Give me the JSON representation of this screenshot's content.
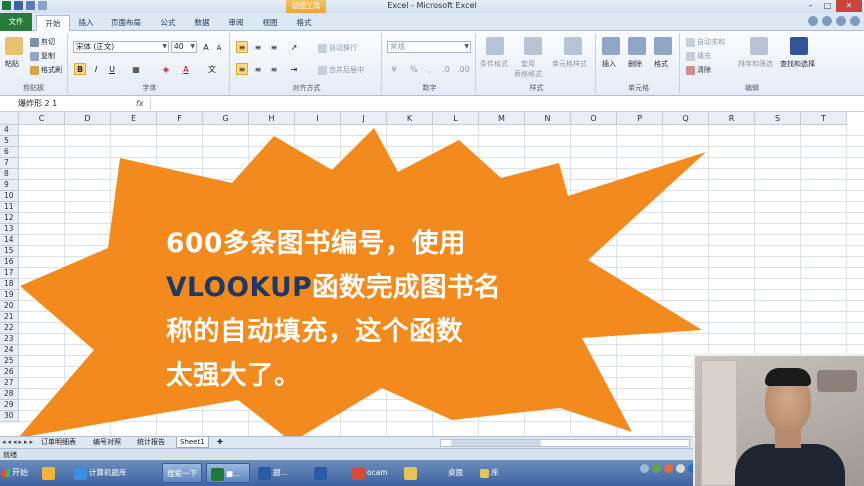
{
  "window": {
    "title": "Excel - Microsoft Excel",
    "context_tab": "绘图工具",
    "minimize": "–",
    "maximize": "□",
    "close": "✕"
  },
  "ribbon_tabs": [
    "文件",
    "开始",
    "插入",
    "页面布局",
    "公式",
    "数据",
    "审阅",
    "视图",
    "格式"
  ],
  "ribbon": {
    "clipboard": {
      "label": "剪贴板",
      "paste": "粘贴",
      "cut": "剪切",
      "copy": "复制",
      "format_painter": "格式刷"
    },
    "font": {
      "label": "字体",
      "font_name": "宋体 (正文)",
      "font_size": "40",
      "bold": "B",
      "italic": "I",
      "underline": "U"
    },
    "alignment": {
      "label": "对齐方式",
      "wrap": "自动换行",
      "merge": "合并后居中"
    },
    "number": {
      "label": "数字",
      "format": "常规",
      "percent": "%",
      "comma": ","
    },
    "styles": {
      "label": "样式",
      "conditional": "条件格式",
      "table": "套用\n表格格式",
      "cell": "单元格样式"
    },
    "cells": {
      "label": "单元格",
      "insert": "插入",
      "delete": "删除",
      "format": "格式"
    },
    "editing": {
      "label": "编辑",
      "autosum": "自动求和",
      "fill": "填充",
      "clear": "清除",
      "sort": "排序和筛选",
      "find": "查找和选择"
    }
  },
  "formula_bar": {
    "name_box": "爆炸形 2 1",
    "fx": "fx",
    "value": ""
  },
  "columns": [
    "C",
    "D",
    "E",
    "F",
    "G",
    "H",
    "I",
    "J",
    "K",
    "L",
    "M",
    "N",
    "O",
    "P",
    "Q",
    "R",
    "S",
    "T"
  ],
  "rows": [
    "4",
    "5",
    "6",
    "7",
    "8",
    "9",
    "10",
    "11",
    "12",
    "13",
    "14",
    "15",
    "16",
    "17",
    "18",
    "19",
    "20",
    "21",
    "22",
    "23",
    "24",
    "25",
    "26",
    "27",
    "28",
    "29",
    "30"
  ],
  "callout": {
    "line1": "600多条图书编号，使用",
    "keyword": "VLOOKUP",
    "line2_rest": "函数完成图书名",
    "line3": "称的自动填充，这个函数",
    "line4": "太强大了。",
    "fill_color": "#f28a1e",
    "text_color": "#ffffff",
    "keyword_color": "#1f3864"
  },
  "sheet_tabs": [
    "订单明细表",
    "编号对照",
    "统计报告",
    "Sheet1"
  ],
  "active_sheet": "Sheet1",
  "status": "就绪",
  "taskbar": {
    "start": "开始",
    "items": [
      "计算机题库",
      "搜索一下",
      "■...",
      "题...",
      "",
      "ocam",
      "",
      "桌面",
      "库"
    ]
  }
}
